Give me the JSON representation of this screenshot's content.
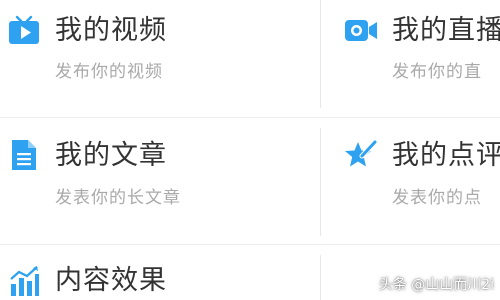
{
  "colors": {
    "icon_blue": "#2ea2f0",
    "title_text": "#333333",
    "subtitle_text": "#a9a9a9",
    "divider": "#e8e8e8"
  },
  "menu": {
    "video": {
      "title": "我的视频",
      "subtitle": "发布你的视频",
      "icon": "tv-play-icon"
    },
    "live": {
      "title": "我的直播",
      "subtitle": "发布你的直",
      "icon": "video-camera-icon"
    },
    "article": {
      "title": "我的文章",
      "subtitle": "发表你的长文章",
      "icon": "document-icon"
    },
    "review": {
      "title": "我的点评",
      "subtitle": "发表你的点",
      "icon": "star-pen-icon"
    },
    "effect": {
      "title": "内容效果",
      "icon": "bar-chart-icon"
    }
  },
  "watermark": "头条 @山山而川2i"
}
